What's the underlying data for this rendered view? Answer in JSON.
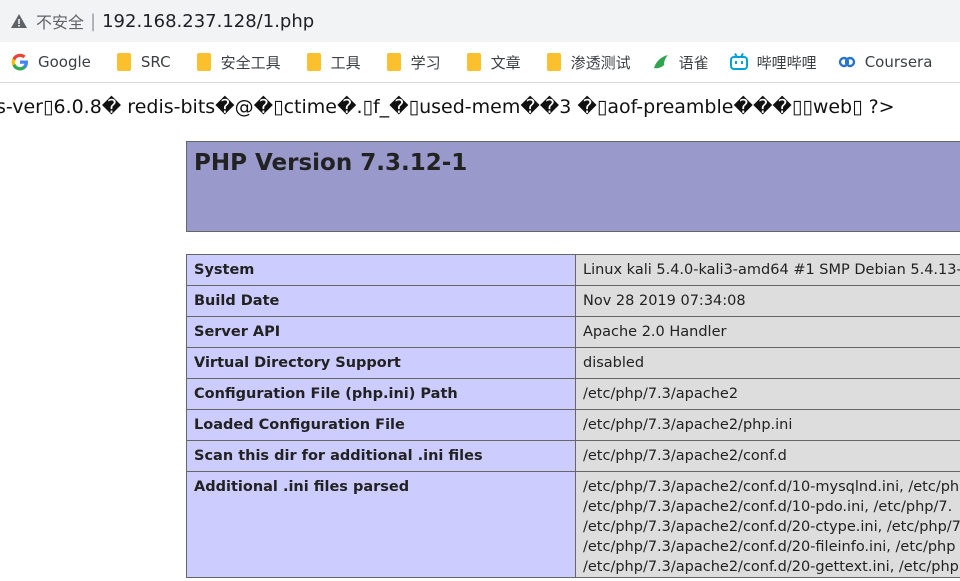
{
  "address_bar": {
    "security_label": "不安全",
    "separator": "|",
    "url": "192.168.237.128/1.php"
  },
  "bookmarks": [
    {
      "label": "Google",
      "icon": "google-icon"
    },
    {
      "label": "SRC",
      "icon": "folder-icon"
    },
    {
      "label": "安全工具",
      "icon": "folder-icon"
    },
    {
      "label": "工具",
      "icon": "folder-icon"
    },
    {
      "label": "学习",
      "icon": "folder-icon"
    },
    {
      "label": "文章",
      "icon": "folder-icon"
    },
    {
      "label": "渗透测试",
      "icon": "folder-icon"
    },
    {
      "label": "语雀",
      "icon": "yuque-icon"
    },
    {
      "label": "哔哩哔哩",
      "icon": "bilibili-icon"
    },
    {
      "label": "Coursera",
      "icon": "coursera-icon"
    }
  ],
  "junk_text": "s-ver▯6.0.8� redis-bits�@�▯ctime�.▯f_�▯used-mem��3 �▯aof-preamble���▯▯web▯ ?>",
  "php": {
    "title": "PHP Version 7.3.12-1",
    "rows": [
      {
        "key": "System",
        "value": "Linux kali 5.4.0-kali3-amd64 #1 SMP Debian 5.4.13-1"
      },
      {
        "key": "Build Date",
        "value": "Nov 28 2019 07:34:08"
      },
      {
        "key": "Server API",
        "value": "Apache 2.0 Handler"
      },
      {
        "key": "Virtual Directory Support",
        "value": "disabled"
      },
      {
        "key": "Configuration File (php.ini) Path",
        "value": "/etc/php/7.3/apache2"
      },
      {
        "key": "Loaded Configuration File",
        "value": "/etc/php/7.3/apache2/php.ini"
      },
      {
        "key": "Scan this dir for additional .ini files",
        "value": "/etc/php/7.3/apache2/conf.d"
      }
    ],
    "additional_ini": {
      "key": "Additional .ini files parsed",
      "lines": [
        "/etc/php/7.3/apache2/conf.d/10-mysqlnd.ini, /etc/php",
        "/etc/php/7.3/apache2/conf.d/10-pdo.ini, /etc/php/7.",
        "/etc/php/7.3/apache2/conf.d/20-ctype.ini, /etc/php/7",
        "/etc/php/7.3/apache2/conf.d/20-fileinfo.ini, /etc/php",
        "/etc/php/7.3/apache2/conf.d/20-gettext.ini, /etc/php"
      ]
    }
  }
}
